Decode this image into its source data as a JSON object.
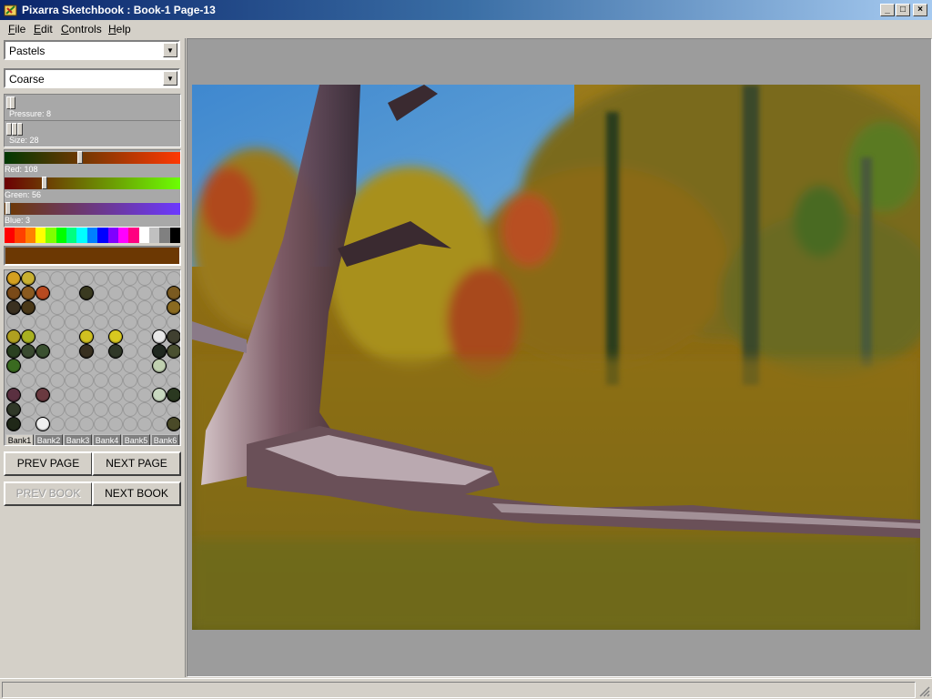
{
  "window": {
    "title": "Pixarra Sketchbook : Book-1 Page-13"
  },
  "menu": [
    {
      "label": "File",
      "key": "F",
      "rest": "ile"
    },
    {
      "label": "Edit",
      "key": "E",
      "rest": "dit"
    },
    {
      "label": "Controls",
      "key": "C",
      "rest": "ontrols"
    },
    {
      "label": "Help",
      "key": "H",
      "rest": "elp"
    }
  ],
  "tool": {
    "selected": "Pastels"
  },
  "texture": {
    "selected": "Coarse"
  },
  "sliders": {
    "pressure": {
      "label": "Pressure: 8",
      "value": 8
    },
    "size": {
      "label": "Size: 28",
      "value": 28
    }
  },
  "color": {
    "red": {
      "label": "Red: 108",
      "value": 108
    },
    "green": {
      "label": "Green: 56",
      "value": 56
    },
    "blue": {
      "label": "Blue: 3",
      "value": 3
    },
    "current": "#6c3803"
  },
  "palette": [
    "#ff0000",
    "#ff4000",
    "#ff8000",
    "#ffff00",
    "#80ff00",
    "#00ff00",
    "#00ff80",
    "#00ffff",
    "#0080ff",
    "#0000ff",
    "#8000ff",
    "#ff00ff",
    "#ff0080",
    "#ffffff",
    "#c0c0c0",
    "#808080",
    "#000000"
  ],
  "banks": {
    "tabs": [
      "Bank1",
      "Bank2",
      "Bank3",
      "Bank4",
      "Bank5",
      "Bank6"
    ],
    "active": 0
  },
  "nav": {
    "prev_page": "PREV PAGE",
    "next_page": "NEXT PAGE",
    "prev_book": "PREV BOOK",
    "next_book": "NEXT BOOK"
  },
  "status": {
    "text": ""
  }
}
